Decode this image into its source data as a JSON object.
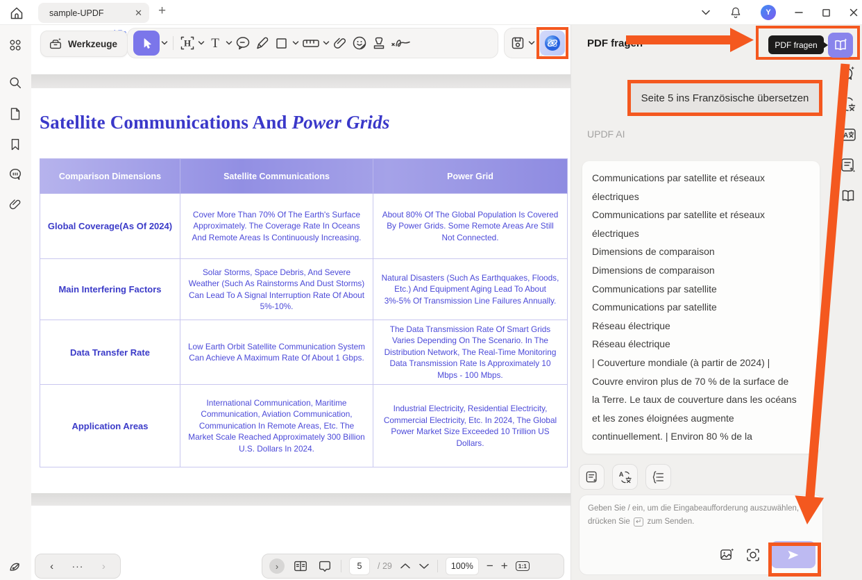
{
  "window": {
    "tab_title": "sample-UPDF"
  },
  "toolbar": {
    "tools_label": "Werkzeuge",
    "obscured_text": "l Fo"
  },
  "document": {
    "title_main": "Satellite Communications And ",
    "title_accent": "Power Grids",
    "table": {
      "headers": [
        "Comparison Dimensions",
        "Satellite Communications",
        "Power Grid"
      ],
      "rows": [
        {
          "dim": "Global Coverage(As Of 2024)",
          "sat": "Cover More Than 70% Of The Earth's Surface Approximately. The Coverage Rate In Oceans And Remote Areas Is Continuously Increasing.",
          "pow": "About 80% Of The Global Population Is Covered By Power Grids. Some Remote Areas Are Still Not Connected."
        },
        {
          "dim": "Main Interfering Factors",
          "sat": "Solar Storms, Space Debris, And Severe Weather (Such As Rainstorms And Dust Storms) Can Lead To A Signal Interruption Rate Of About 5%-10%.",
          "pow": "Natural Disasters (Such As Earthquakes, Floods, Etc.) And Equipment Aging Lead To About 3%-5% Of Transmission Line Failures Annually."
        },
        {
          "dim": "Data Transfer Rate",
          "sat": "Low Earth Orbit Satellite Communication System Can Achieve A Maximum Rate Of About 1 Gbps.",
          "pow": "The Data Transmission Rate Of Smart Grids Varies Depending On The Scenario. In The Distribution Network, The Real-Time Monitoring Data Transmission Rate Is Approximately 10 Mbps - 100 Mbps."
        },
        {
          "dim": "Application Areas",
          "sat": "International Communication, Maritime Communication, Aviation Communication, Communication In Remote Areas, Etc. The Market Scale Reached Approximately 300 Billion U.S. Dollars In 2024.",
          "pow": "Industrial Electricity, Residential Electricity, Commercial Electricity, Etc. In 2024, The Global Power Market Size Exceeded 10 Trillion US Dollars."
        }
      ]
    }
  },
  "right_panel": {
    "title": "PDF fragen",
    "tooltip": "PDF fragen",
    "suggestion": "Seite 5 ins Französische übersetzen",
    "ai_label": "UPDF AI",
    "chat_lines": [
      "Communications par satellite et réseaux",
      "électriques",
      "Communications par satellite et réseaux",
      "électriques",
      "Dimensions de comparaison",
      "Dimensions de comparaison",
      "Communications par satellite",
      "Communications par satellite",
      "Réseau électrique",
      "Réseau électrique",
      "| Couverture mondiale (à partir de 2024) |",
      "Couvre environ plus de 70 % de la surface de",
      "la Terre. Le taux de couverture dans les océans",
      "et les zones éloignées augmente",
      "continuellement. | Environ 80 % de la"
    ],
    "placeholder_line1": "Geben Sie / ein, um die Eingabeaufforderung auszuwählen,",
    "placeholder_line2_pre": "drücken Sie",
    "enter_key": "↵",
    "placeholder_line2_post": "zum Senden."
  },
  "footer": {
    "more": "···",
    "page_current": "5",
    "page_total": "/ 29",
    "zoom_level": "100%",
    "ratio_label": "1:1"
  },
  "colors": {
    "annotation_orange": "#f4581f",
    "accent_purple": "#7b76ea",
    "send_lavender": "#bdbaf2",
    "table_text_blue": "#4b49d8",
    "title_blue": "#3a38c9"
  }
}
